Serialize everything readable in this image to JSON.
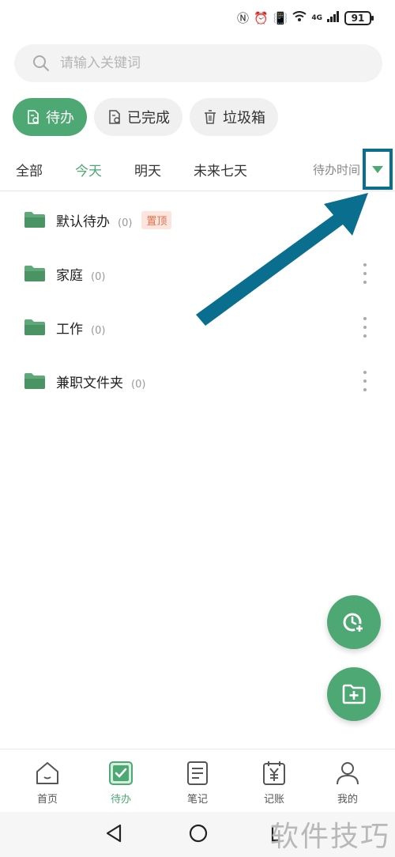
{
  "status_bar": {
    "network": "4G",
    "battery": "91"
  },
  "search": {
    "placeholder": "请输入关键词"
  },
  "filters": [
    {
      "label": "待办",
      "active": true,
      "icon": "todo-doc-icon"
    },
    {
      "label": "已完成",
      "active": false,
      "icon": "done-doc-icon"
    },
    {
      "label": "垃圾箱",
      "active": false,
      "icon": "trash-icon"
    }
  ],
  "tabs": [
    {
      "label": "全部",
      "active": false
    },
    {
      "label": "今天",
      "active": true
    },
    {
      "label": "明天",
      "active": false
    },
    {
      "label": "未来七天",
      "active": false
    }
  ],
  "sort": {
    "label": "待办时间",
    "icon": "triangle-down-icon"
  },
  "folders": [
    {
      "name": "默认待办",
      "count": "(0)",
      "badge": "置顶"
    },
    {
      "name": "家庭",
      "count": "(0)"
    },
    {
      "name": "工作",
      "count": "(0)"
    },
    {
      "name": "兼职文件夹",
      "count": "(0)"
    }
  ],
  "fabs": [
    {
      "icon": "add-reminder-icon"
    },
    {
      "icon": "add-folder-icon"
    }
  ],
  "bottom_nav": [
    {
      "label": "首页",
      "icon": "home-icon",
      "active": false
    },
    {
      "label": "待办",
      "icon": "todo-check-icon",
      "active": true
    },
    {
      "label": "笔记",
      "icon": "note-icon",
      "active": false
    },
    {
      "label": "记账",
      "icon": "ledger-icon",
      "active": false
    },
    {
      "label": "我的",
      "icon": "profile-icon",
      "active": false
    }
  ],
  "watermark": "软件技巧",
  "colors": {
    "accent": "#4ea873",
    "annotation": "#0a6e8f",
    "badge_bg": "#fde4dc",
    "badge_text": "#e0734f"
  }
}
